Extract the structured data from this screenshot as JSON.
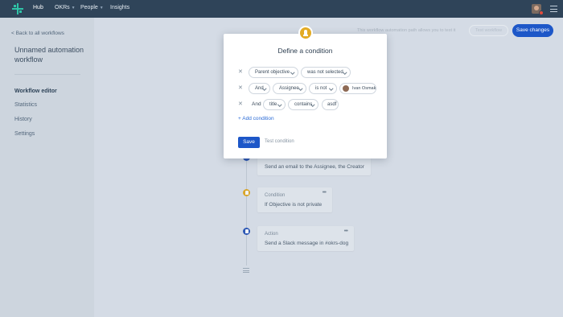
{
  "nav": {
    "items": [
      {
        "label": "Hub"
      },
      {
        "label": "OKRs"
      },
      {
        "label": "People"
      },
      {
        "label": "Insights"
      }
    ]
  },
  "sidebar": {
    "back_label": "< Back to all workflows",
    "workflow_title": "Unnamed automation workflow",
    "items": [
      {
        "label": "Workflow editor"
      },
      {
        "label": "Statistics"
      },
      {
        "label": "History"
      },
      {
        "label": "Settings"
      }
    ]
  },
  "toolbar": {
    "hint": "This workflow automation path allows you to test it",
    "test_workflow_label": "Test workflow",
    "save_changes_label": "Save changes"
  },
  "timeline": {
    "cards": [
      {
        "type": "Action",
        "text": "Send an email to the Assignee, the Creator"
      },
      {
        "type": "Condition",
        "text": "If Objective is not private"
      },
      {
        "type": "Action",
        "text": "Send a Slack message in #okrs-dog"
      }
    ]
  },
  "modal": {
    "title": "Define a condition",
    "rows": [
      {
        "field": "Parent objective",
        "operator": "was not selected"
      },
      {
        "connector": "And",
        "field": "Assignee",
        "operator": "is not",
        "value_user": "Ivan Osmak"
      },
      {
        "connector": "And",
        "field": "title",
        "operator": "contains",
        "value_text": "asdf"
      }
    ],
    "add_condition_label": "+ Add condition",
    "save_label": "Save",
    "test_condition_label": "Test condition"
  },
  "colors": {
    "topbar": "#2f4459",
    "primary": "#1d57c8",
    "condition_yellow": "#e3ab24",
    "link_blue": "#2b6bd6"
  }
}
